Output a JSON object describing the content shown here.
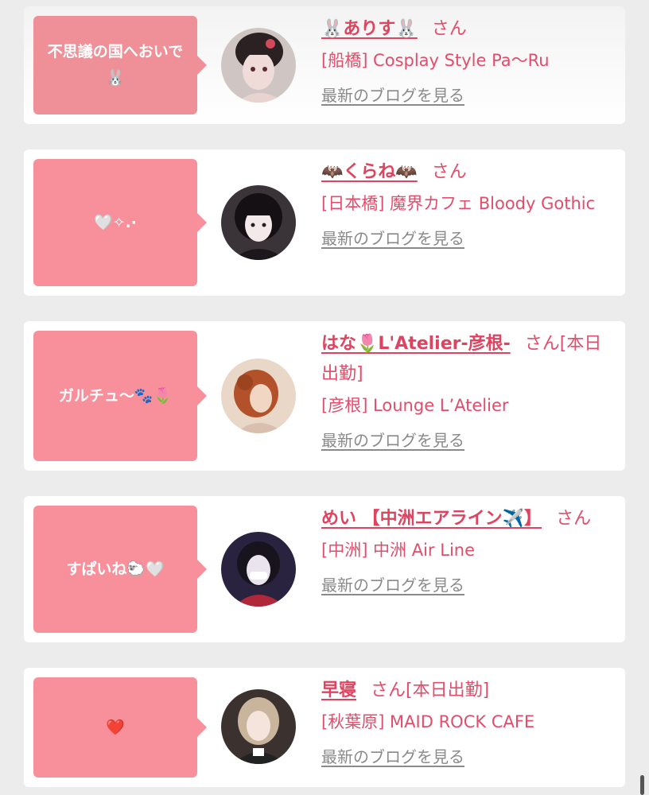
{
  "entries": [
    {
      "message": "不思議の国へおいで🐰",
      "name": "🐰ありす🐰",
      "san": "さん",
      "shop": "[船橋] Cosplay Style Pa〜Ru",
      "blog_link": "最新のブログを見る"
    },
    {
      "message": "🤍✧.·",
      "name": "🦇くらね🦇",
      "san": "さん",
      "shop": "[日本橋] 魔界カフェ Bloody Gothic",
      "blog_link": "最新のブログを見る"
    },
    {
      "message": "ガルチュ〜🐾🌷",
      "name": "はな🌷L'Atelier-彦根-",
      "san": "さん[本日出勤]",
      "shop": "[彦根] Lounge L’Atelier",
      "blog_link": "最新のブログを見る"
    },
    {
      "message": "すぱいね🐑🤍",
      "name": "めい 【中洲エアライン✈️】",
      "san": "さん",
      "shop": "[中洲] 中洲 Air Line",
      "blog_link": "最新のブログを見る"
    },
    {
      "message": "❤️",
      "name": "早寝",
      "san": "さん[本日出勤]",
      "shop": "[秋葉原] MAID ROCK CAFE",
      "blog_link": "最新のブログを見る"
    }
  ]
}
